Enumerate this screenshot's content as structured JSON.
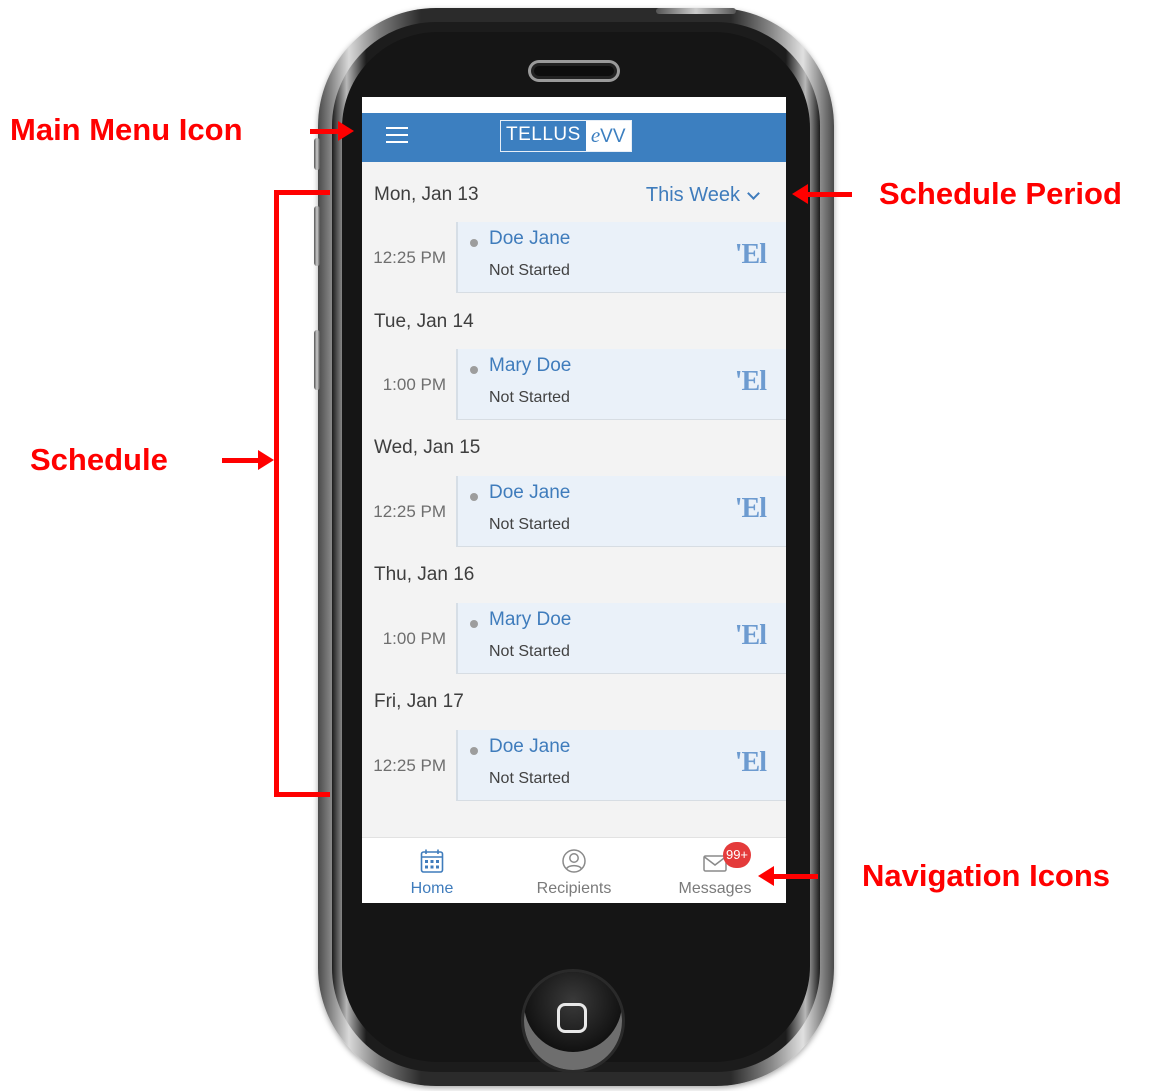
{
  "annotations": {
    "main_menu": "Main Menu Icon",
    "schedule_period": "Schedule Period",
    "schedule": "Schedule",
    "navigation": "Navigation Icons"
  },
  "header": {
    "logo_left": "TELLUS",
    "logo_right_e": "e",
    "logo_right_vv": "VV"
  },
  "schedule": {
    "period": "This Week",
    "days": [
      {
        "label": "Mon, Jan 13",
        "time": "12:25 PM",
        "name": "Doe Jane",
        "status": "Not Started",
        "badge": "'El"
      },
      {
        "label": "Tue, Jan 14",
        "time": "1:00 PM",
        "name": "Mary Doe",
        "status": "Not Started",
        "badge": "'El"
      },
      {
        "label": "Wed, Jan 15",
        "time": "12:25 PM",
        "name": "Doe Jane",
        "status": "Not Started",
        "badge": "'El"
      },
      {
        "label": "Thu, Jan 16",
        "time": "1:00 PM",
        "name": "Mary Doe",
        "status": "Not Started",
        "badge": "'El"
      },
      {
        "label": "Fri, Jan 17",
        "time": "12:25 PM",
        "name": "Doe Jane",
        "status": "Not Started",
        "badge": "'El"
      }
    ]
  },
  "nav": {
    "home": "Home",
    "recipients": "Recipients",
    "messages": "Messages",
    "messages_badge": "99+"
  },
  "colors": {
    "header_blue": "#3c7fc0",
    "link_blue": "#3f7cbc",
    "annotation_red": "#ff0000",
    "badge_red": "#e43b3b"
  }
}
